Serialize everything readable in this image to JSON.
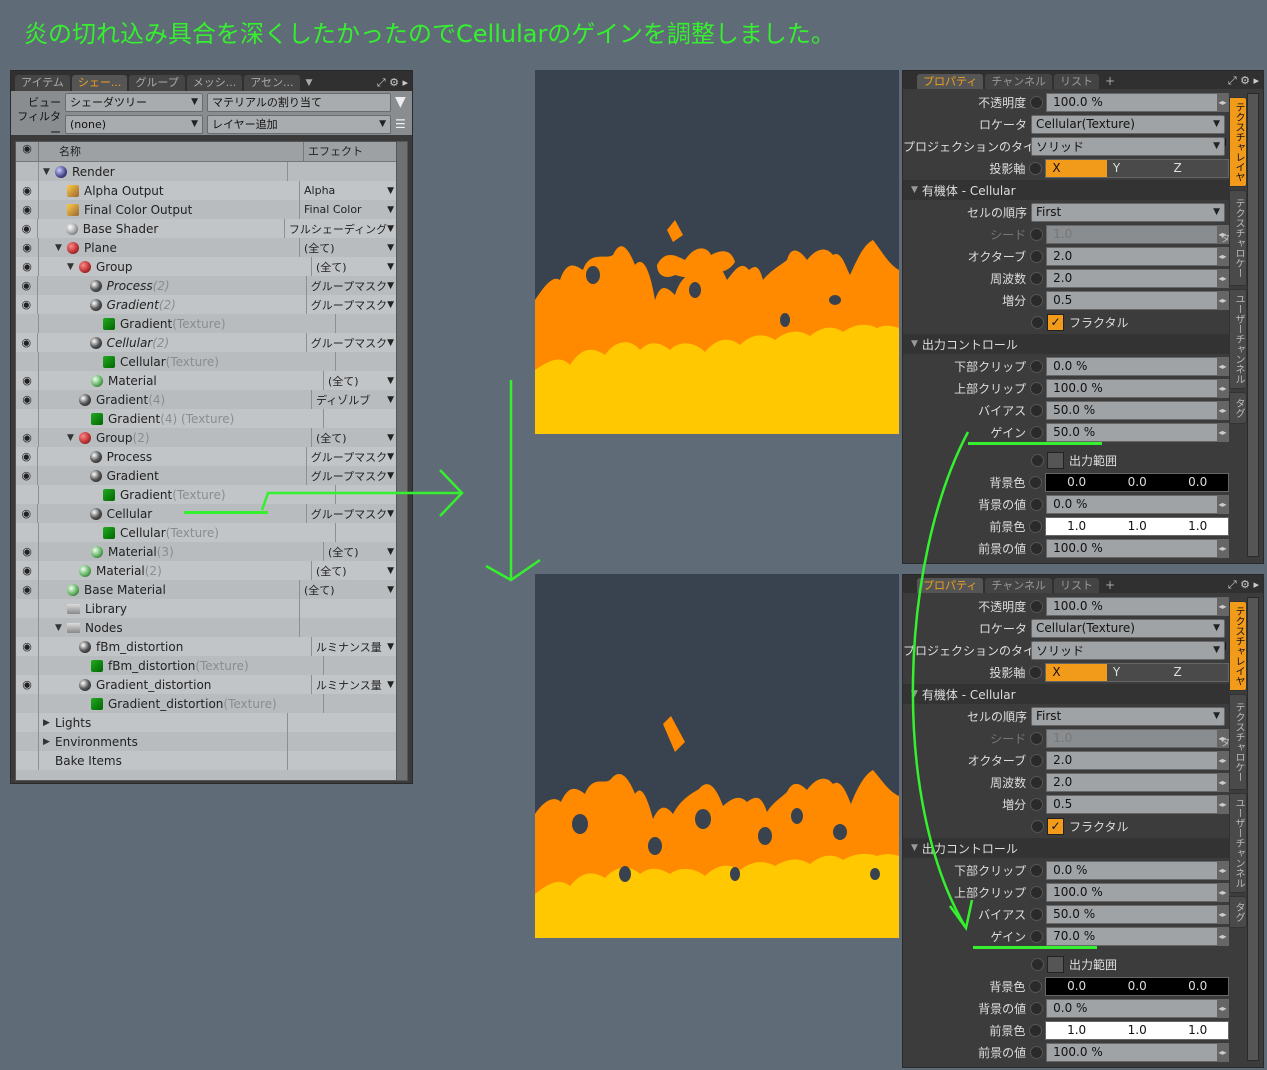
{
  "headline": "炎の切れ込み具合を深くしたかったのでCellularのゲインを調整しました。",
  "tree_panel": {
    "tabs": [
      "アイテム",
      "シェー...",
      "グループ",
      "メッシ...",
      "アセン..."
    ],
    "active_tab": 1,
    "view_label": "ビュー",
    "view_value": "シェーダツリー",
    "assign_material": "マテリアルの割り当て",
    "filter_label": "フィルター",
    "filter_value": "(none)",
    "add_layer": "レイヤー追加",
    "col_name": "名称",
    "col_effect": "エフェクト",
    "rows": [
      {
        "indent": 0,
        "eye": false,
        "exp": "▼",
        "icon": "rnd",
        "name": "Render",
        "suffix": "",
        "effect": "",
        "italic": false
      },
      {
        "indent": 1,
        "eye": true,
        "exp": "",
        "icon": "out",
        "name": "Alpha Output",
        "suffix": "",
        "effect": "Alpha",
        "italic": false
      },
      {
        "indent": 1,
        "eye": true,
        "exp": "",
        "icon": "out",
        "name": "Final Color Output",
        "suffix": "",
        "effect": "Final Color",
        "italic": false
      },
      {
        "indent": 1,
        "eye": true,
        "exp": "",
        "icon": "shd",
        "name": "Base Shader",
        "suffix": "",
        "effect": "フルシェーディング",
        "italic": false
      },
      {
        "indent": 1,
        "eye": true,
        "exp": "▼",
        "icon": "grp",
        "name": "Plane",
        "suffix": "",
        "effect": "(全て)",
        "italic": false
      },
      {
        "indent": 2,
        "eye": true,
        "exp": "▼",
        "icon": "grp",
        "name": "Group",
        "suffix": "",
        "effect": "(全て)",
        "italic": false
      },
      {
        "indent": 3,
        "eye": true,
        "exp": "",
        "icon": "layer",
        "name": "Process",
        "suffix": " (2)",
        "effect": "グループマスク",
        "italic": true
      },
      {
        "indent": 3,
        "eye": true,
        "exp": "",
        "icon": "layer",
        "name": "Gradient",
        "suffix": " (2)",
        "effect": "グループマスク",
        "italic": true
      },
      {
        "indent": 4,
        "eye": false,
        "exp": "",
        "icon": "tex",
        "name": "Gradient",
        "suffix": " (Texture)",
        "effect": "",
        "italic": false
      },
      {
        "indent": 3,
        "eye": true,
        "exp": "",
        "icon": "layer",
        "name": "Cellular",
        "suffix": " (2)",
        "effect": "グループマスク",
        "italic": true
      },
      {
        "indent": 4,
        "eye": false,
        "exp": "",
        "icon": "tex",
        "name": "Cellular",
        "suffix": "(Texture)",
        "effect": "",
        "italic": false
      },
      {
        "indent": 3,
        "eye": true,
        "exp": "",
        "icon": "mat",
        "name": "Material",
        "suffix": "",
        "effect": "(全て)",
        "italic": false
      },
      {
        "indent": 2,
        "eye": true,
        "exp": "",
        "icon": "layer",
        "name": "Gradient",
        "suffix": " (4)",
        "effect": "ディゾルブ",
        "italic": false
      },
      {
        "indent": 3,
        "eye": false,
        "exp": "",
        "icon": "tex",
        "name": "Gradient",
        "suffix": " (4) (Texture)",
        "effect": "",
        "italic": false
      },
      {
        "indent": 2,
        "eye": true,
        "exp": "▼",
        "icon": "grp",
        "name": "Group",
        "suffix": " (2)",
        "effect": "(全て)",
        "italic": false
      },
      {
        "indent": 3,
        "eye": true,
        "exp": "",
        "icon": "layer",
        "name": "Process",
        "suffix": "",
        "effect": "グループマスク",
        "italic": false
      },
      {
        "indent": 3,
        "eye": true,
        "exp": "",
        "icon": "layer",
        "name": "Gradient",
        "suffix": "",
        "effect": "グループマスク",
        "italic": false
      },
      {
        "indent": 4,
        "eye": false,
        "exp": "",
        "icon": "tex",
        "name": "Gradient",
        "suffix": " (Texture)",
        "effect": "",
        "italic": false
      },
      {
        "indent": 3,
        "eye": true,
        "exp": "",
        "icon": "layer",
        "name": "Cellular",
        "suffix": "",
        "effect": "グループマスク",
        "italic": false
      },
      {
        "indent": 4,
        "eye": false,
        "exp": "",
        "icon": "tex",
        "name": "Cellular",
        "suffix": "(Texture)",
        "effect": "",
        "italic": false
      },
      {
        "indent": 3,
        "eye": true,
        "exp": "",
        "icon": "mat",
        "name": "Material",
        "suffix": " (3)",
        "effect": "(全て)",
        "italic": false
      },
      {
        "indent": 2,
        "eye": true,
        "exp": "",
        "icon": "mat",
        "name": "Material",
        "suffix": " (2)",
        "effect": "(全て)",
        "italic": false
      },
      {
        "indent": 1,
        "eye": true,
        "exp": "",
        "icon": "mat",
        "name": "Base Material",
        "suffix": "",
        "effect": "(全て)",
        "italic": false
      },
      {
        "indent": 1,
        "eye": false,
        "exp": "",
        "icon": "fold",
        "name": "Library",
        "suffix": "",
        "effect": "",
        "italic": false
      },
      {
        "indent": 1,
        "eye": false,
        "exp": "▼",
        "icon": "fold",
        "name": "Nodes",
        "suffix": "",
        "effect": "",
        "italic": false
      },
      {
        "indent": 2,
        "eye": true,
        "exp": "",
        "icon": "layer",
        "name": "fBm_distortion",
        "suffix": "",
        "effect": "ルミナンス量",
        "italic": false
      },
      {
        "indent": 3,
        "eye": false,
        "exp": "",
        "icon": "tex",
        "name": "fBm_distortion",
        "suffix": " (Texture)",
        "effect": "",
        "italic": false
      },
      {
        "indent": 2,
        "eye": true,
        "exp": "",
        "icon": "layer",
        "name": "Gradient_distortion",
        "suffix": "",
        "effect": "ルミナンス量",
        "italic": false
      },
      {
        "indent": 3,
        "eye": false,
        "exp": "",
        "icon": "tex",
        "name": "Gradient_distortion",
        "suffix": " (Texture)",
        "effect": "",
        "italic": false
      },
      {
        "indent": 0,
        "eye": false,
        "exp": "▶",
        "icon": "",
        "name": "Lights",
        "suffix": "",
        "effect": "",
        "italic": false
      },
      {
        "indent": 0,
        "eye": false,
        "exp": "▶",
        "icon": "",
        "name": "Environments",
        "suffix": "",
        "effect": "",
        "italic": false
      },
      {
        "indent": 0,
        "eye": false,
        "exp": "",
        "icon": "",
        "name": "Bake Items",
        "suffix": "",
        "effect": "",
        "italic": false
      }
    ]
  },
  "prop_panels": [
    {
      "tabs": [
        "プロパティ",
        "チャンネル",
        "リスト"
      ],
      "opacity_label": "不透明度",
      "opacity": "100.0 %",
      "locator_label": "ロケータ",
      "locator": "Cellular(Texture)",
      "projection_label": "プロジェクションのタイプ",
      "projection": "ソリッド",
      "axis_label": "投影軸",
      "axis_x": "X",
      "axis_y": "Y",
      "axis_z": "Z",
      "section_cellular": "有機体 - Cellular",
      "cell_order_label": "セルの順序",
      "cell_order": "First",
      "seed_label": "シード",
      "seed": "1.0",
      "octave_label": "オクターブ",
      "octave": "2.0",
      "freq_label": "周波数",
      "freq": "2.0",
      "incr_label": "増分",
      "incr": "0.5",
      "fractal_label": "フラクタル",
      "section_output": "出力コントロール",
      "low_clip_label": "下部クリップ",
      "low_clip": "0.0 %",
      "high_clip_label": "上部クリップ",
      "high_clip": "100.0 %",
      "bias_label": "バイアス",
      "bias": "50.0 %",
      "gain_label": "ゲイン",
      "gain": "50.0 %",
      "range_label": "出力範囲",
      "bg_color_label": "背景色",
      "bg_color": [
        "0.0",
        "0.0",
        "0.0"
      ],
      "bg_value_label": "背景の値",
      "bg_value": "0.0 %",
      "fg_color_label": "前景色",
      "fg_color": [
        "1.0",
        "1.0",
        "1.0"
      ],
      "fg_value_label": "前景の値",
      "fg_value": "100.0 %",
      "side_tabs": [
        "テクスチャレイヤー",
        "テクスチャロケータ",
        "ユーザーチャンネル",
        "タグ"
      ]
    },
    {
      "tabs": [
        "プロパティ",
        "チャンネル",
        "リスト"
      ],
      "opacity_label": "不透明度",
      "opacity": "100.0 %",
      "locator_label": "ロケータ",
      "locator": "Cellular(Texture)",
      "projection_label": "プロジェクションのタイプ",
      "projection": "ソリッド",
      "axis_label": "投影軸",
      "axis_x": "X",
      "axis_y": "Y",
      "axis_z": "Z",
      "section_cellular": "有機体 - Cellular",
      "cell_order_label": "セルの順序",
      "cell_order": "First",
      "seed_label": "シード",
      "seed": "1.0",
      "octave_label": "オクターブ",
      "octave": "2.0",
      "freq_label": "周波数",
      "freq": "2.0",
      "incr_label": "増分",
      "incr": "0.5",
      "fractal_label": "フラクタル",
      "section_output": "出力コントロール",
      "low_clip_label": "下部クリップ",
      "low_clip": "0.0 %",
      "high_clip_label": "上部クリップ",
      "high_clip": "100.0 %",
      "bias_label": "バイアス",
      "bias": "50.0 %",
      "gain_label": "ゲイン",
      "gain": "70.0 %",
      "range_label": "出力範囲",
      "bg_color_label": "背景色",
      "bg_color": [
        "0.0",
        "0.0",
        "0.0"
      ],
      "bg_value_label": "背景の値",
      "bg_value": "0.0 %",
      "fg_color_label": "前景色",
      "fg_color": [
        "1.0",
        "1.0",
        "1.0"
      ],
      "fg_value_label": "前景の値",
      "fg_value": "100.0 %",
      "side_tabs": [
        "テクスチャレイヤー",
        "テクスチャロケータ",
        "ユーザーチャンネル",
        "タグ"
      ]
    }
  ],
  "colors": {
    "annotation_green": "#35f02f",
    "accent_orange": "#f29a1a",
    "flame_yellow": "#ffc800",
    "flame_orange": "#ff8a00",
    "preview_bg": "#38434f"
  }
}
